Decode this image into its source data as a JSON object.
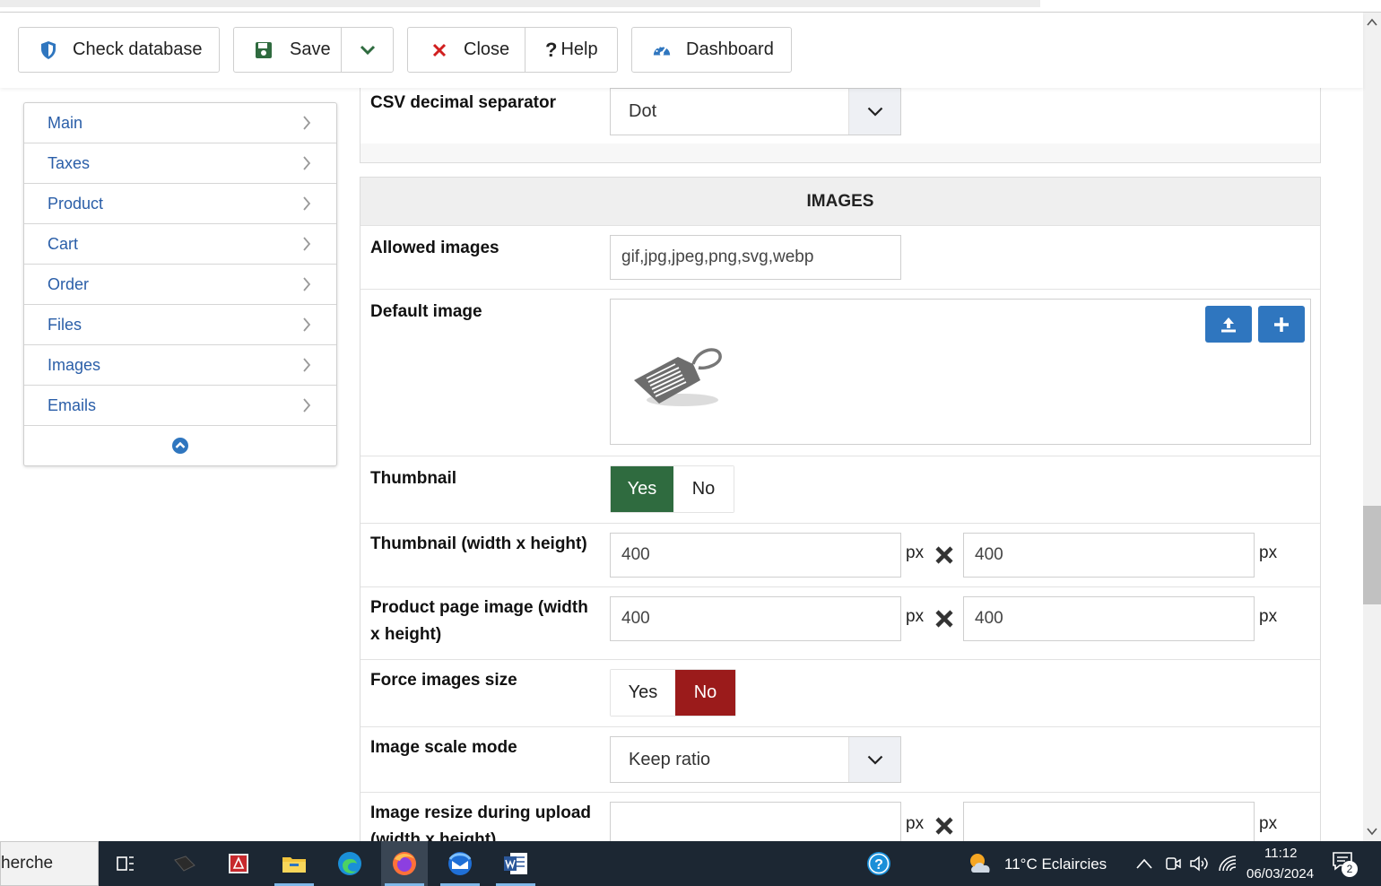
{
  "toolbar": {
    "check_database": "Check database",
    "save": "Save",
    "close": "Close",
    "help": "Help",
    "dashboard": "Dashboard"
  },
  "sidebar": {
    "items": [
      {
        "label": "Main"
      },
      {
        "label": "Taxes"
      },
      {
        "label": "Product"
      },
      {
        "label": "Cart"
      },
      {
        "label": "Order"
      },
      {
        "label": "Files"
      },
      {
        "label": "Images"
      },
      {
        "label": "Emails"
      }
    ]
  },
  "csv": {
    "label": "CSV decimal separator",
    "value": "Dot"
  },
  "images": {
    "section_title": "IMAGES",
    "allowed_label": "Allowed images",
    "allowed_value": "gif,jpg,jpeg,png,svg,webp",
    "default_label": "Default image",
    "thumbnail_label": "Thumbnail",
    "thumbnail_yes": "Yes",
    "thumbnail_no": "No",
    "thumb_size_label": "Thumbnail (width x height)",
    "thumb_width": "400",
    "thumb_height": "400",
    "product_size_label": "Product page image (width x height)",
    "product_width": "400",
    "product_height": "400",
    "force_label": "Force images size",
    "force_yes": "Yes",
    "force_no": "No",
    "scale_label": "Image scale mode",
    "scale_value": "Keep ratio",
    "resize_label": "Image resize during upload (width x height)",
    "resize_width": "",
    "resize_height": "",
    "unit": "px"
  },
  "taskbar": {
    "search_text": "herche",
    "weather": "11°C  Eclaircies",
    "time": "11:12",
    "date": "06/03/2024",
    "notification_count": "2"
  },
  "colors": {
    "link_blue": "#2a5ea8",
    "yes_green": "#2f6b3f",
    "no_red": "#9b1b1b",
    "action_blue": "#2f76bf"
  }
}
